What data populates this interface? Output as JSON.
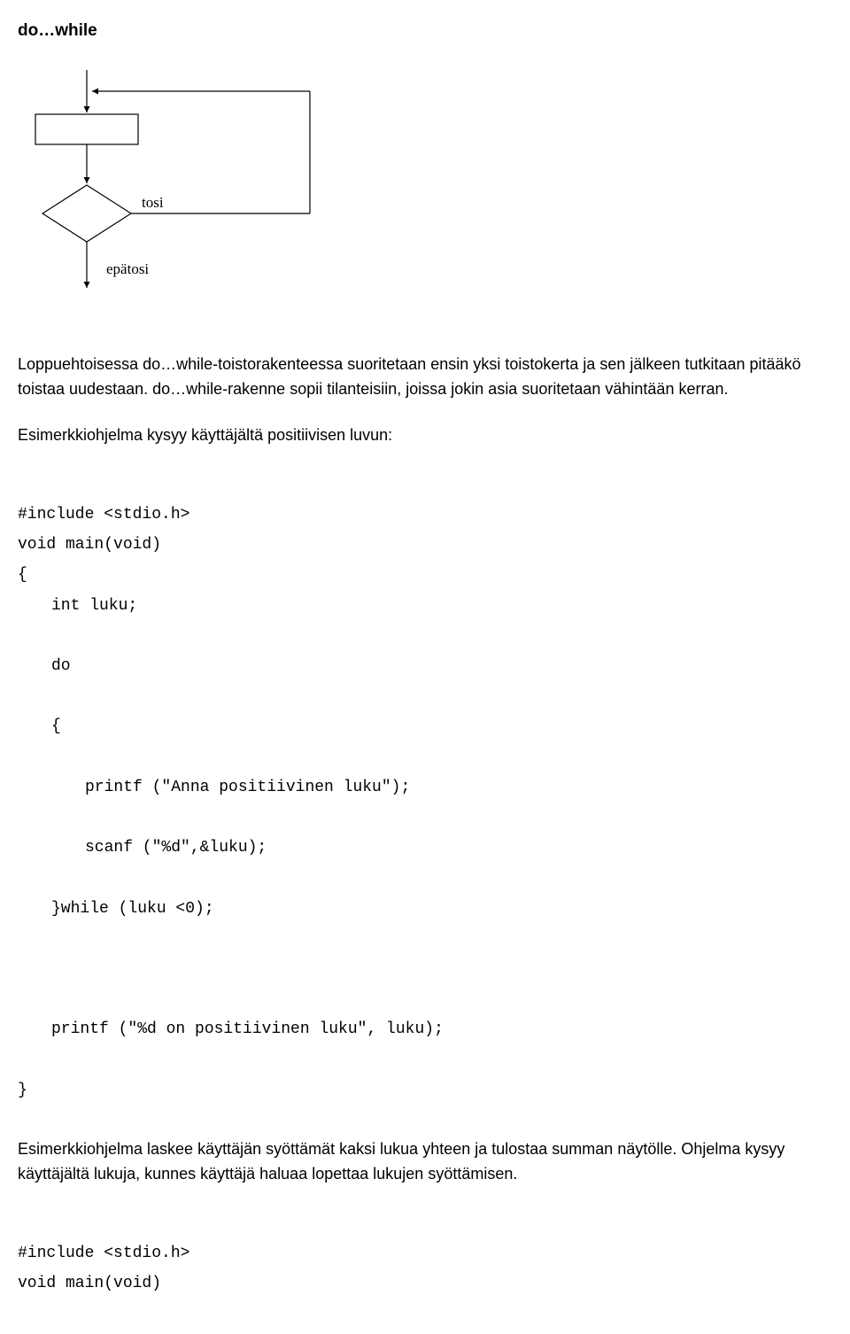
{
  "heading": "do…while",
  "flowchart": {
    "tosi": "tosi",
    "epatosi": "epätosi"
  },
  "para1_a": "Loppuehtoisessa do…while-toistorakenteessa suoritetaan ensin yksi toistokerta ja sen ",
  "para1_b": "jälkeen tutkitaan pitääkö toistaa uudestaan. do…while-rakenne sopii tilanteisiin, joissa ",
  "para1_c": "jokin asia suoritetaan vähintään kerran.",
  "para2": "Esimerkkiohjelma kysyy käyttäjältä positiivisen luvun:",
  "code1": {
    "l1": "#include <stdio.h>",
    "l2": "void main(void)",
    "l3": "{",
    "l4": "int luku;",
    "l5": "do",
    "l6": "{",
    "l7": "printf (\"Anna positiivinen luku\");",
    "l8": "scanf (\"%d\",&luku);",
    "l9": "}while (luku <0);",
    "l10": "printf (\"%d on positiivinen luku\", luku);",
    "l11": "}"
  },
  "para3_a": "Esimerkkiohjelma laskee käyttäjän syöttämät kaksi lukua yhteen ja tulostaa summan ",
  "para3_b": "näytölle. Ohjelma kysyy käyttäjältä lukuja, kunnes käyttäjä haluaa lopettaa lukujen ",
  "para3_c": "syöttämisen.",
  "code2": {
    "l1": "#include <stdio.h>",
    "l2": "void main(void)"
  }
}
